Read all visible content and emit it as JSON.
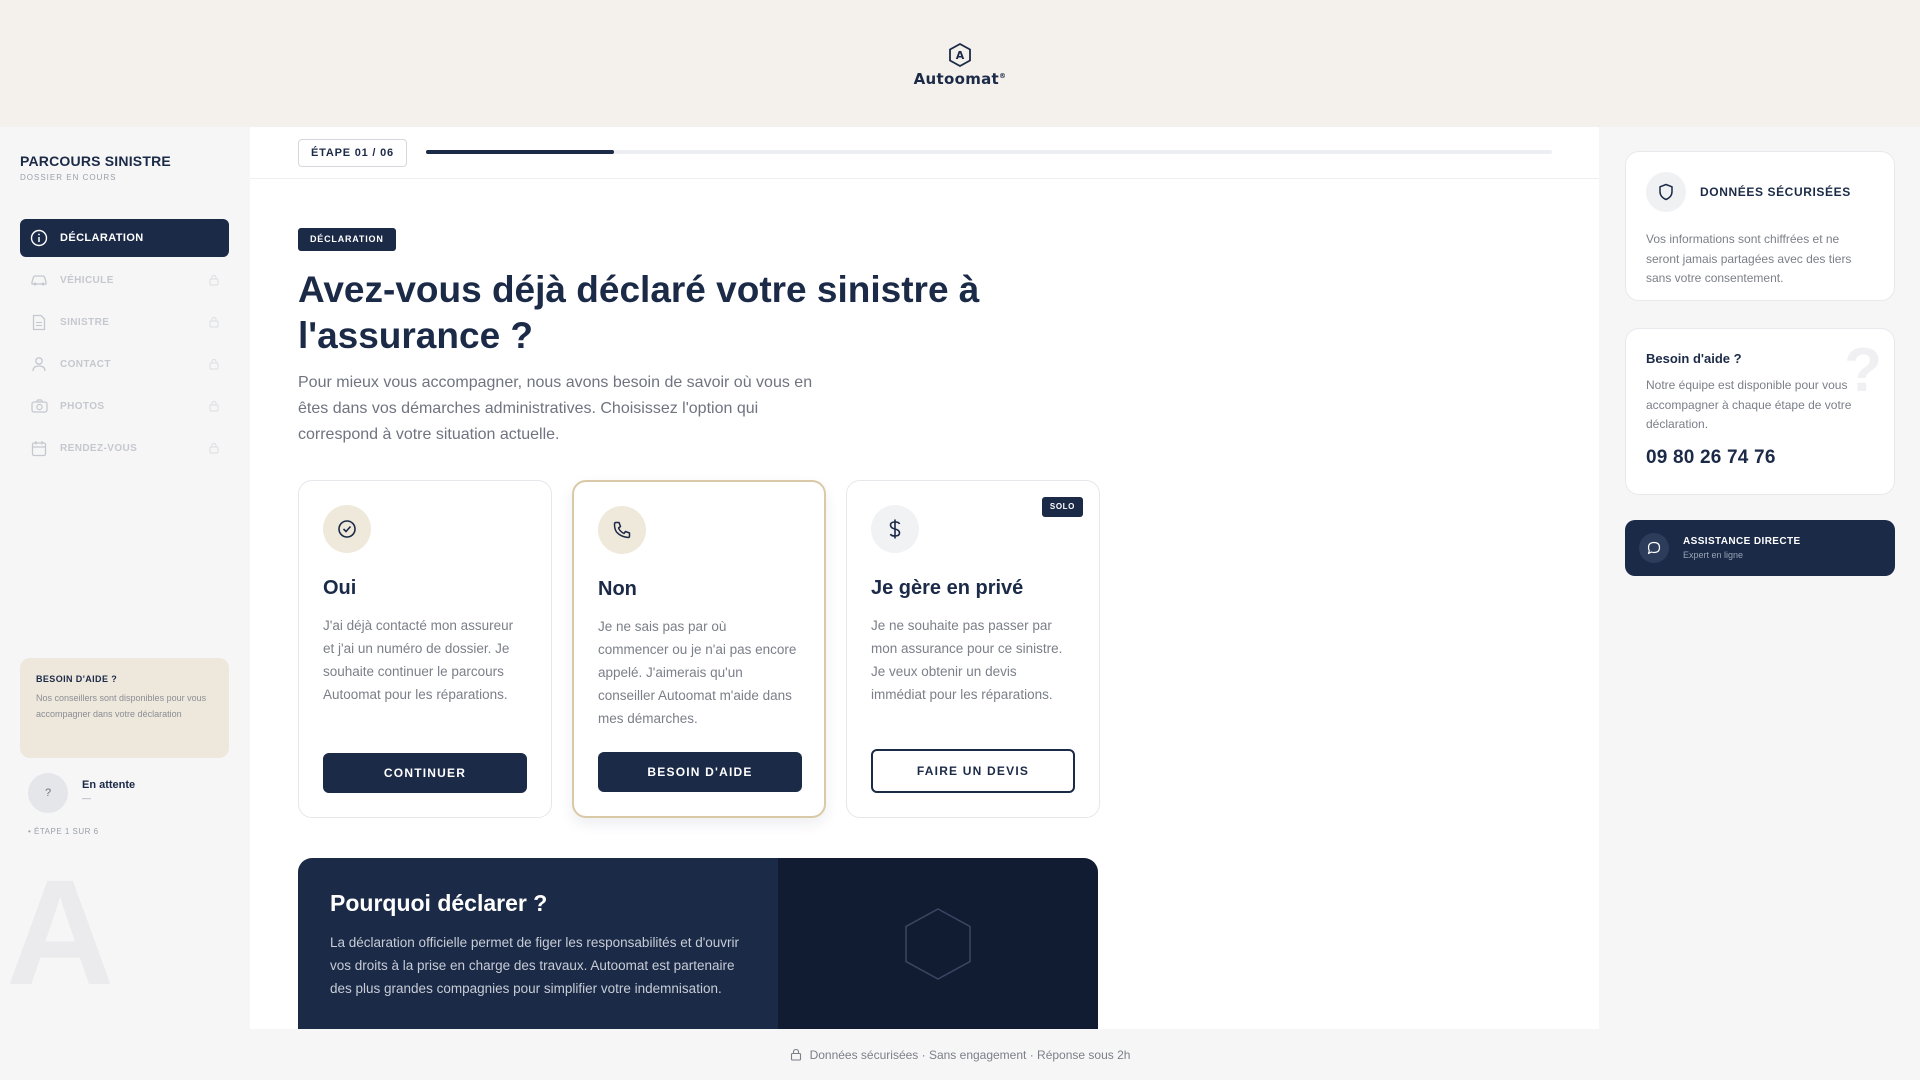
{
  "brand": {
    "name": "Autoomat",
    "mark": "®"
  },
  "sidebar": {
    "title": "PARCOURS SINISTRE",
    "subtitle": "DOSSIER EN COURS",
    "items": [
      {
        "label": "DÉCLARATION",
        "icon": "info-icon",
        "state": "active"
      },
      {
        "label": "VÉHICULE",
        "icon": "car-icon",
        "state": "locked"
      },
      {
        "label": "SINISTRE",
        "icon": "document-icon",
        "state": "locked"
      },
      {
        "label": "CONTACT",
        "icon": "user-icon",
        "state": "locked"
      },
      {
        "label": "PHOTOS",
        "icon": "camera-icon",
        "state": "locked"
      },
      {
        "label": "RENDEZ-VOUS",
        "icon": "calendar-icon",
        "state": "locked"
      }
    ],
    "help": {
      "title": "BESOIN D'AIDE ?",
      "text": "Nos conseillers sont disponibles pour vous accompagner dans votre déclaration"
    },
    "status": {
      "avatar": "?",
      "name": "En attente",
      "sub": "—"
    },
    "step_note": "• ÉTAPE 1 SUR 6",
    "watermark": "A"
  },
  "progress": {
    "step_label": "ÉTAPE 01 / 06",
    "fraction": 0.1667
  },
  "main": {
    "tag": "DÉCLARATION",
    "headline": "Avez-vous déjà déclaré votre sinistre à l'assurance ?",
    "intro": "Pour mieux vous accompagner, nous avons besoin de savoir où vous en êtes dans vos démarches administratives. Choisissez l'option qui correspond à votre situation actuelle.",
    "options": [
      {
        "title": "Oui",
        "icon": "check-circle-icon",
        "text": "J'ai déjà contacté mon assureur et j'ai un numéro de dossier. Je souhaite continuer le parcours Autoomat pour les réparations.",
        "button": "CONTINUER"
      },
      {
        "title": "Non",
        "icon": "phone-icon",
        "text": "Je ne sais pas par où commencer ou je n'ai pas encore appelé. J'aimerais qu'un conseiller Autoomat m'aide dans mes démarches.",
        "button": "BESOIN D'AIDE"
      },
      {
        "title": "Je gère en privé",
        "icon": "dollar-icon",
        "text": "Je ne souhaite pas passer par mon assurance pour ce sinistre. Je veux obtenir un devis immédiat pour les réparations.",
        "button": "FAIRE UN DEVIS",
        "badge": "SOLO"
      }
    ],
    "why": {
      "title": "Pourquoi déclarer ?",
      "text": "La déclaration officielle permet de figer les responsabilités et d'ouvrir vos droits à la prise en charge des travaux. Autoomat est partenaire des plus grandes compagnies pour simplifier votre indemnisation."
    }
  },
  "right": {
    "secure": {
      "title": "DONNÉES SÉCURISÉES",
      "text": "Vos informations sont chiffrées et ne seront jamais partagées avec des tiers sans votre consentement."
    },
    "help": {
      "title": "Besoin d'aide ?",
      "text": "Notre équipe est disponible pour vous accompagner à chaque étape de votre déclaration.",
      "phone": "09 80 26 74 76",
      "watermark": "?"
    },
    "assist": {
      "title": "ASSISTANCE DIRECTE",
      "sub": "Expert en ligne"
    }
  },
  "footer": {
    "text": "Données sécurisées · Sans engagement · Réponse sous 2h"
  },
  "colors": {
    "navy": "#1b2a47",
    "beige": "#f4f1ec",
    "accent_border": "#d9c9a6"
  }
}
